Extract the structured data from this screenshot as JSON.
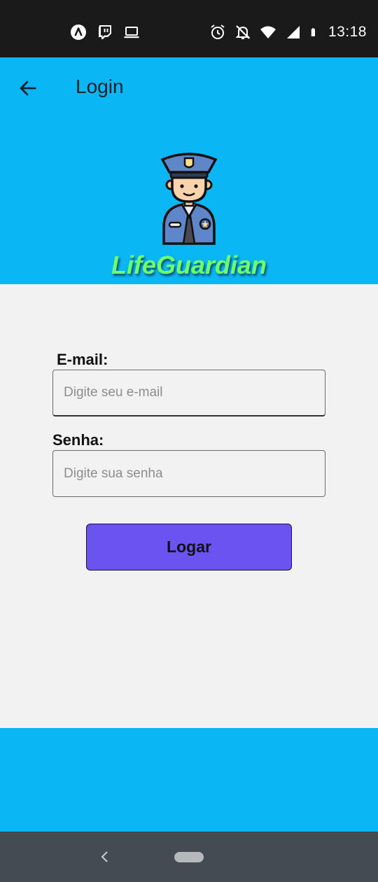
{
  "status_bar": {
    "time": "13:18",
    "left_icons": [
      "app-a-icon",
      "twitch-icon",
      "laptop-icon"
    ],
    "right_icons": [
      "alarm-icon",
      "notifications-off-icon",
      "wifi-icon",
      "signal-icon",
      "battery-icon"
    ]
  },
  "app_bar": {
    "title": "Login",
    "back_icon": "arrow-left-icon"
  },
  "header": {
    "brand_name": "LifeGuardian",
    "logo_icon": "police-officer-icon"
  },
  "form": {
    "email_label": "E-mail:",
    "email_placeholder": "Digite seu e-mail",
    "email_value": "",
    "password_label": "Senha:",
    "password_placeholder": "Digite sua senha",
    "password_value": "",
    "submit_label": "Logar"
  },
  "navigation": {
    "back_icon": "chevron-left-icon",
    "home_icon": "home-pill-icon"
  },
  "colors": {
    "primary": "#0bb6f4",
    "button": "#6a53f0",
    "brand_text": "#6dff6d",
    "background": "#f2f2f2",
    "status_bar": "#1a1a1a",
    "nav_bar": "#454b52"
  }
}
